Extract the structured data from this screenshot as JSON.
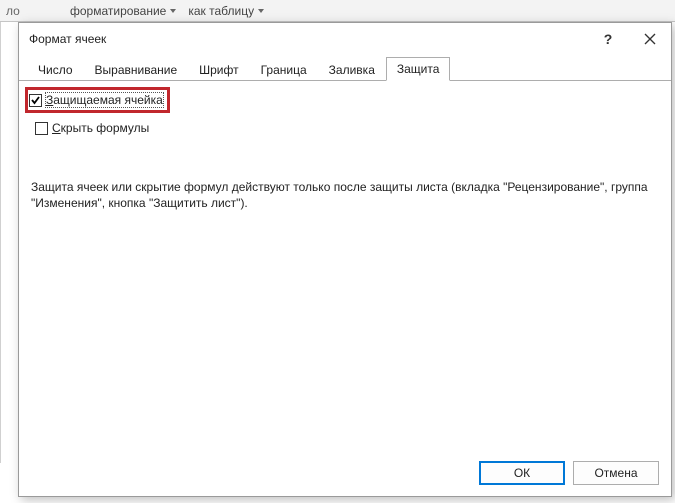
{
  "ribbon": {
    "item1": "форматирование",
    "item2": "как таблицу"
  },
  "dialog": {
    "title": "Формат ячеек",
    "tabs": [
      {
        "label": "Число"
      },
      {
        "label": "Выравнивание"
      },
      {
        "label": "Шрифт"
      },
      {
        "label": "Граница"
      },
      {
        "label": "Заливка"
      },
      {
        "label": "Защита"
      }
    ],
    "protection": {
      "locked_prefix": "З",
      "locked_rest": "ащищаемая ячейка",
      "hidden_prefix": "С",
      "hidden_rest": "крыть формулы",
      "description": "Защита ячеек или скрытие формул действуют только после защиты листа (вкладка \"Рецензирование\", группа \"Изменения\", кнопка \"Защитить лист\")."
    },
    "buttons": {
      "ok": "ОК",
      "cancel": "Отмена"
    }
  }
}
